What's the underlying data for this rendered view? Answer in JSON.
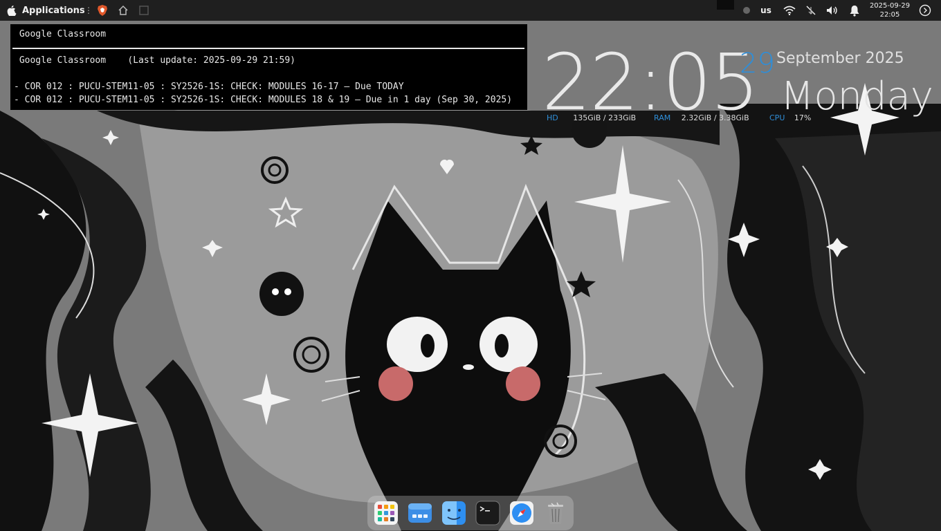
{
  "top_panel": {
    "apps_label": "Applications",
    "keyboard_layout": "us",
    "date": "2025-09-29",
    "time": "22:05",
    "icons": [
      "apple-icon",
      "grip-icon",
      "brave-browser-icon",
      "home-icon",
      "terminal-icon",
      "status-dot-icon",
      "wifi-icon",
      "network-disconnected-icon",
      "volume-icon",
      "notification-bell-icon",
      "power-icon"
    ]
  },
  "terminal": {
    "title_glyph": "",
    "title": "Google Classroom",
    "header": "Google Classroom    (Last update: 2025-09-29 21:59)",
    "items": [
      "- COR 012 : PUCU-STEM11-05 : SY2526-1S: CHECK: MODULES 16-17 — Due TODAY",
      "- COR 012 : PUCU-STEM11-05 : SY2526-1S: CHECK: MODULES 18 & 19 — Due in 1 day (Sep 30, 2025)"
    ]
  },
  "conky": {
    "time": "22:05",
    "day": "29",
    "month_year": "September 2025",
    "weekday": "Monday",
    "hd_label": "HD",
    "hd_value": "135GiB / 233GiB",
    "ram_label": "RAM",
    "ram_value": "2.32GiB / 3.38GiB",
    "cpu_label": "CPU",
    "cpu_value": "17%",
    "accent": "#2f8ed8"
  },
  "dock": {
    "items": [
      "launchpad-icon",
      "files-icon",
      "finder-icon",
      "terminal-icon",
      "safari-icon",
      "trash-icon"
    ]
  }
}
